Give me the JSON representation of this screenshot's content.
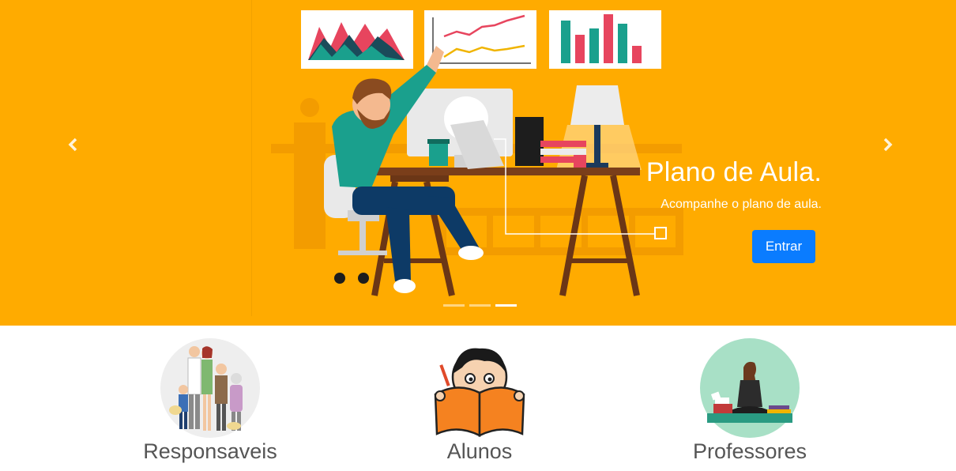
{
  "carousel": {
    "prev_icon": "chevron-left-icon",
    "next_icon": "chevron-right-icon",
    "slide": {
      "title": "Plano de Aula.",
      "text": "Acompanhe o plano de aula.",
      "button_label": "Entrar",
      "illustration": "man-at-desk-with-charts-illustration"
    },
    "indicator_count": 3,
    "active_indicator": 3,
    "colors": {
      "background": "#ffab00",
      "button": "#0a7cff"
    }
  },
  "roles": [
    {
      "label": "Responsaveis",
      "icon": "family-group-image"
    },
    {
      "label": "Alunos",
      "icon": "student-reading-book-image"
    },
    {
      "label": "Professores",
      "icon": "teacher-meditating-image"
    }
  ]
}
